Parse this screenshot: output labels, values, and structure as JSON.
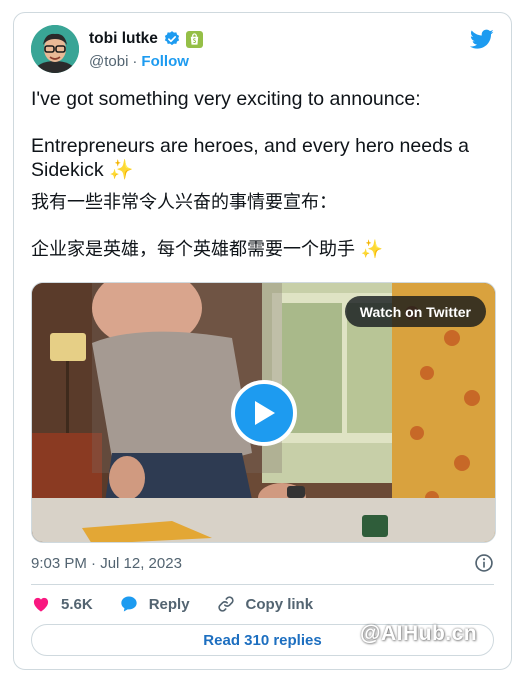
{
  "author": {
    "name": "tobi lutke",
    "handle": "@tobi",
    "separator": "·",
    "follow_label": "Follow"
  },
  "tweet": {
    "line1": "I've got something very exciting to announce:",
    "line2": "Entrepreneurs are heroes, and every hero needs a",
    "line3_text": "Sidekick",
    "sparkle": "✨",
    "line4": "我有一些非常令人兴奋的事情要宣布：",
    "line5_text": "企业家是英雄，每个英雄都需要一个助手"
  },
  "media": {
    "watch_label": "Watch on Twitter"
  },
  "meta": {
    "timestamp": "9:03 PM · Jul 12, 2023"
  },
  "actions": {
    "likes": "5.6K",
    "reply_label": "Reply",
    "copy_label": "Copy link"
  },
  "replies_button": "Read 310 replies",
  "watermark": "@AIHub.cn",
  "colors": {
    "accent": "#1d9bf0",
    "like": "#f91880",
    "shopify": "#95bf47"
  }
}
